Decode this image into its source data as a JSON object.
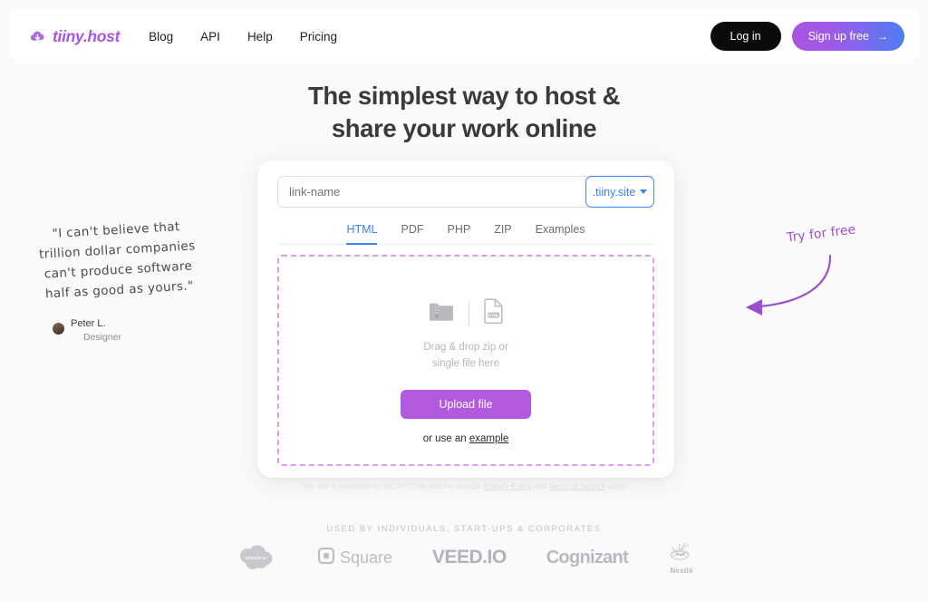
{
  "brand": {
    "name": "tiiny.host",
    "logo_icon": "cloud-download-icon",
    "color": "#a855e0"
  },
  "nav": {
    "links": [
      {
        "label": "Blog"
      },
      {
        "label": "API"
      },
      {
        "label": "Help"
      },
      {
        "label": "Pricing"
      }
    ],
    "login_label": "Log in",
    "signup_label": "Sign up free",
    "signup_arrow": "→",
    "signup_gradient_from": "#a855e0",
    "signup_gradient_to": "#4f7df3",
    "login_bg": "#0b0b0b"
  },
  "hero": {
    "headline_line1": "The simplest way to host &",
    "headline_line2": "share your work online"
  },
  "card": {
    "url": {
      "value": "",
      "placeholder": "link-name",
      "domain_label": ".tiiny.site",
      "domain_caret_icon": "chevron-down-icon",
      "domain_color": "#3b82f6"
    },
    "tabs": [
      {
        "label": "HTML",
        "active": true
      },
      {
        "label": "PDF",
        "active": false
      },
      {
        "label": "PHP",
        "active": false
      },
      {
        "label": "ZIP",
        "active": false
      },
      {
        "label": "Examples",
        "active": false
      }
    ],
    "dropzone": {
      "zip_icon": "zip-folder-icon",
      "file_icon": "html-file-icon",
      "file_icon_label": "HTML",
      "hint_line1": "Drag & drop zip or",
      "hint_line2": "single file here",
      "upload_label": "Upload file",
      "upload_color": "#b15ae0",
      "example_prefix": "or use an ",
      "example_link": "example",
      "border_color": "#e09bf0"
    },
    "recaptcha": {
      "part1": "This site is protected by reCAPTCHA and the Google ",
      "privacy_link": "Privacy Policy",
      "part2": " and ",
      "terms_link": "Terms of Service",
      "part3": " apply."
    }
  },
  "testimonial": {
    "quote_line1": "\"I can't believe that",
    "quote_line2": "trillion dollar companies",
    "quote_line3": "can't produce software",
    "quote_line4": "half as good as yours.\"",
    "author_name": "Peter L.",
    "author_role": "Designer",
    "avatar_icon": "user-avatar"
  },
  "annotation": {
    "text": "Try for free",
    "arrow_icon": "curved-arrow-left-icon",
    "color": "#9b4fd0"
  },
  "social_proof": {
    "heading": "USED BY INDIVIDUALS, START-UPS & CORPORATES",
    "logos": [
      {
        "name": "salesforce",
        "label": "salesforce"
      },
      {
        "name": "square",
        "label": "Square"
      },
      {
        "name": "veed-io",
        "label": "VEED.IO"
      },
      {
        "name": "cognizant",
        "label": "Cognizant"
      },
      {
        "name": "nestle",
        "label": "Nestlé"
      }
    ]
  }
}
